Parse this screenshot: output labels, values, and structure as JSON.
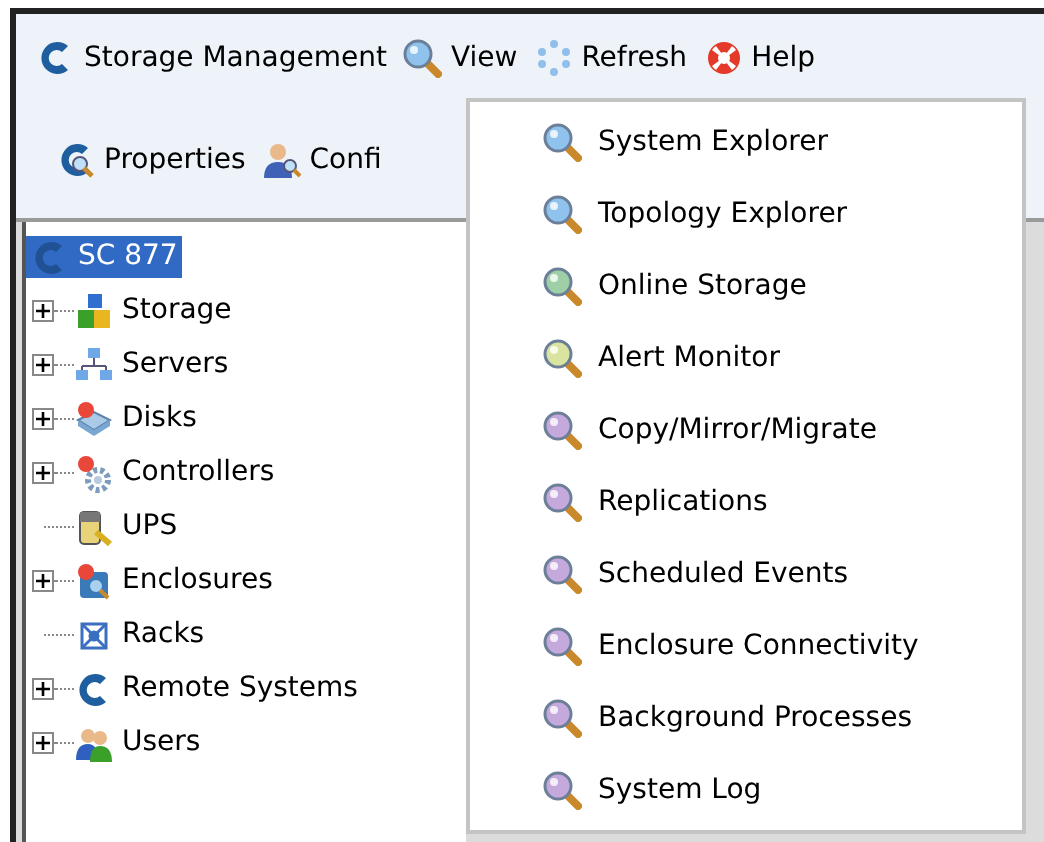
{
  "menu_bar": [
    {
      "label": "Storage Management"
    },
    {
      "label": "View"
    },
    {
      "label": "Refresh"
    },
    {
      "label": "Help"
    }
  ],
  "toolbar": [
    {
      "label": "Properties"
    },
    {
      "label": "Confi"
    }
  ],
  "tree": {
    "label": "SC 877",
    "selected": true,
    "children": [
      {
        "label": "Storage",
        "kind": "branch"
      },
      {
        "label": "Servers",
        "kind": "branch"
      },
      {
        "label": "Disks",
        "kind": "branch"
      },
      {
        "label": "Controllers",
        "kind": "branch"
      },
      {
        "label": "UPS",
        "kind": "leaf"
      },
      {
        "label": "Enclosures",
        "kind": "branch"
      },
      {
        "label": "Racks",
        "kind": "leaf"
      },
      {
        "label": "Remote Systems",
        "kind": "branch"
      },
      {
        "label": "Users",
        "kind": "branch"
      }
    ]
  },
  "view_menu": [
    {
      "label": "System Explorer",
      "color": "#8fc3ee"
    },
    {
      "label": "Topology Explorer",
      "color": "#8fc3ee"
    },
    {
      "label": "Online Storage",
      "color": "#9ecfa6"
    },
    {
      "label": "Alert Monitor",
      "color": "#d9e4a0"
    },
    {
      "label": "Copy/Mirror/Migrate",
      "color": "#c6a9dc"
    },
    {
      "label": "Replications",
      "color": "#c6a9dc"
    },
    {
      "label": "Scheduled Events",
      "color": "#c6a9dc"
    },
    {
      "label": "Enclosure Connectivity",
      "color": "#c6a9dc"
    },
    {
      "label": "Background Processes",
      "color": "#c6a9dc"
    },
    {
      "label": "System Log",
      "color": "#c6a9dc"
    }
  ]
}
